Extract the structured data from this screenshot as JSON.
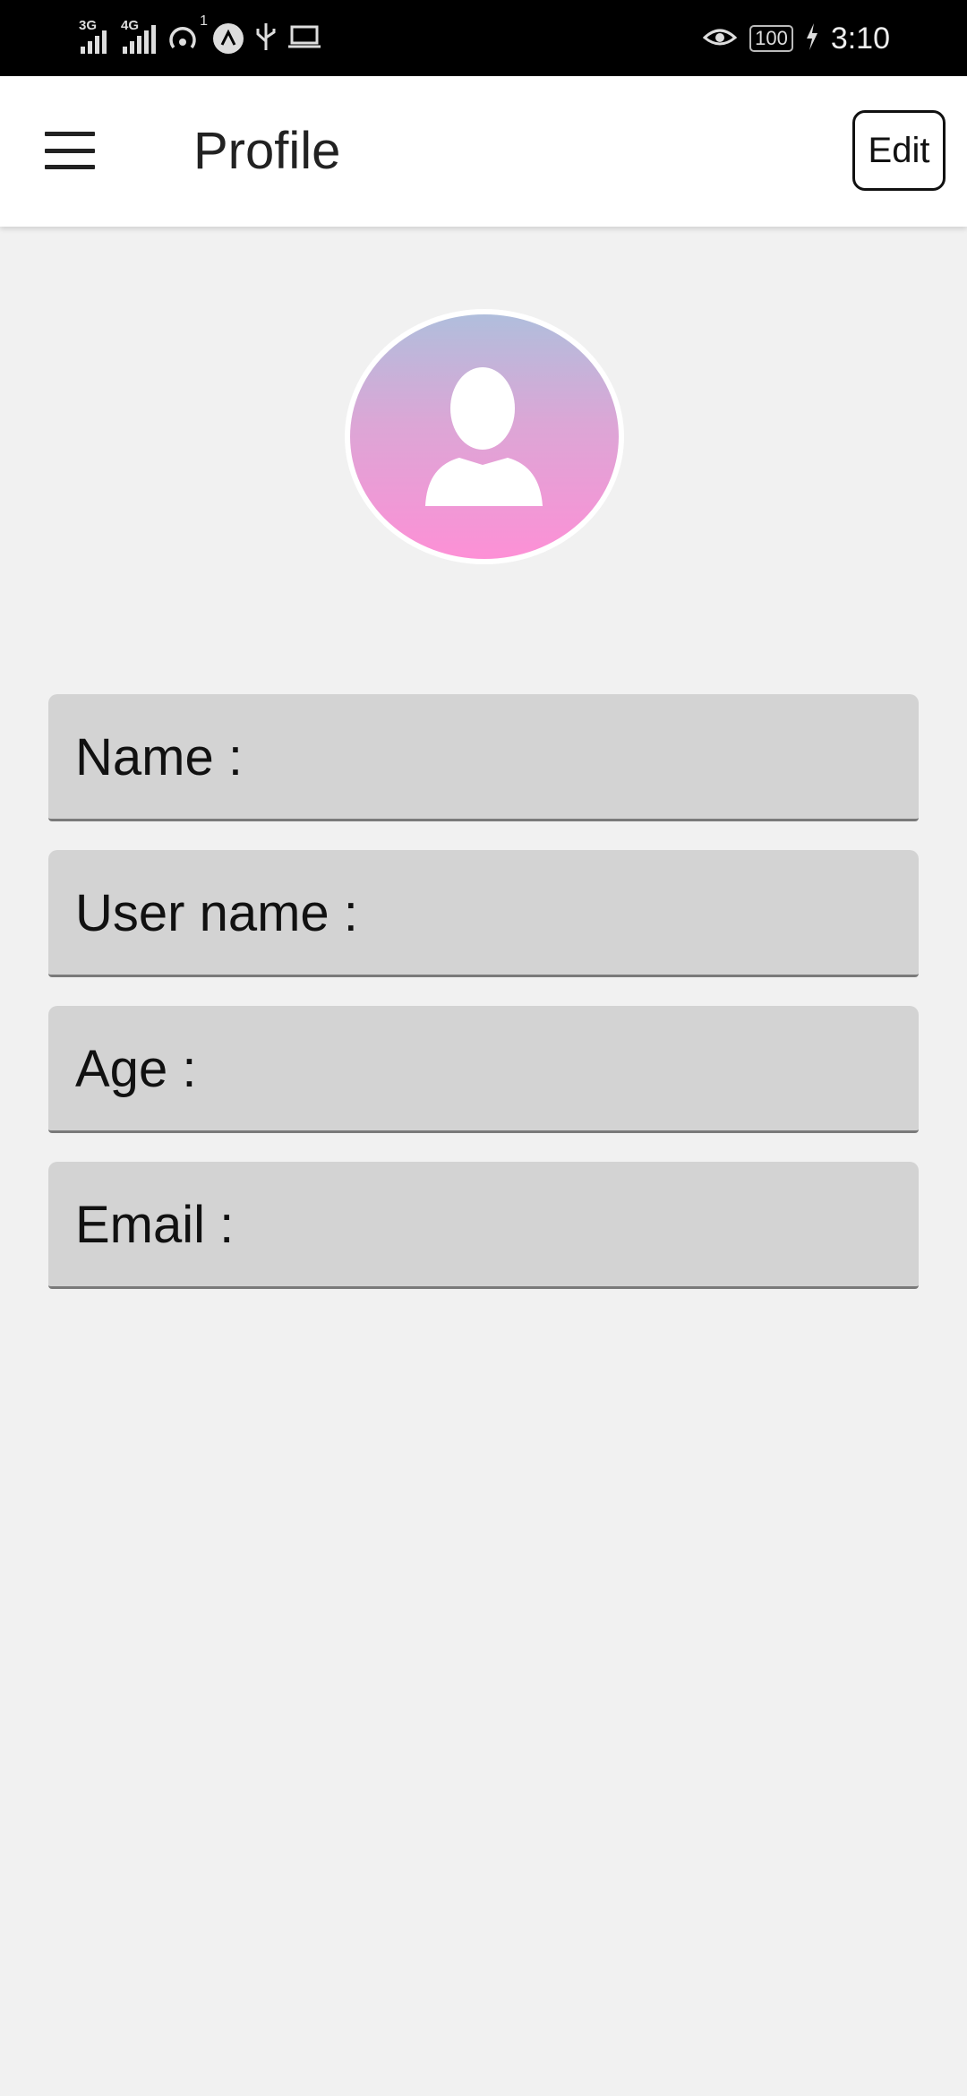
{
  "status_bar": {
    "network_1": "3G",
    "network_2": "4G",
    "hotspot_count": "1",
    "battery": "100",
    "time": "3:10",
    "icons": [
      "signal-icon",
      "signal-icon",
      "hotspot-icon",
      "vpn-icon",
      "usb-icon",
      "laptop-icon",
      "eye-icon",
      "battery-icon",
      "charging-icon"
    ]
  },
  "app_bar": {
    "title": "Profile",
    "edit_label": "Edit",
    "menu_icon": "hamburger-menu-icon"
  },
  "avatar": {
    "icon": "person-silhouette-icon",
    "gradient_top": "#b0bedc",
    "gradient_bottom": "#fd90d6"
  },
  "fields": {
    "name_label": "Name :",
    "username_label": "User name :",
    "age_label": "Age :",
    "email_label": "Email :"
  },
  "colors": {
    "background": "#f1f1f1",
    "field_bg": "#d3d3d3",
    "app_bar_bg": "#ffffff"
  }
}
